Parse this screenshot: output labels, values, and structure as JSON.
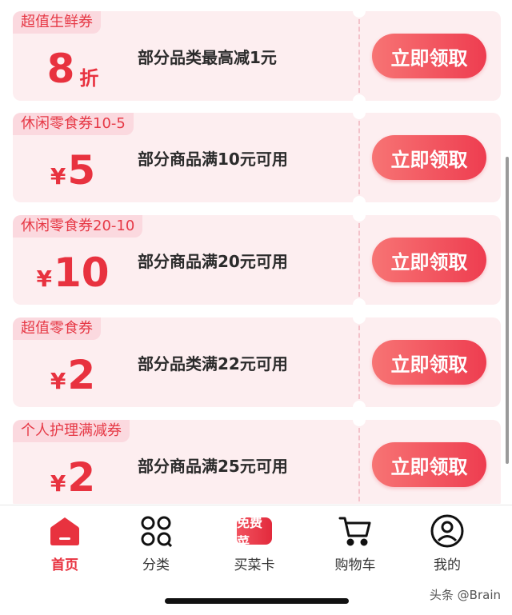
{
  "coupons": [
    {
      "tag": "超值生鲜券",
      "symbol": "",
      "amount": "8",
      "unit": "折",
      "desc": "部分品类最高减1元",
      "button": "立即领取"
    },
    {
      "tag": "休闲零食券10-5",
      "symbol": "¥",
      "amount": "5",
      "unit": "",
      "desc": "部分商品满10元可用",
      "button": "立即领取"
    },
    {
      "tag": "休闲零食券20-10",
      "symbol": "¥",
      "amount": "10",
      "unit": "",
      "desc": "部分商品满20元可用",
      "button": "立即领取"
    },
    {
      "tag": "超值零食券",
      "symbol": "¥",
      "amount": "2",
      "unit": "",
      "desc": "部分品类满22元可用",
      "button": "立即领取"
    },
    {
      "tag": "个人护理满减券",
      "symbol": "¥",
      "amount": "2",
      "unit": "",
      "desc": "部分商品满25元可用",
      "button": "立即领取"
    }
  ],
  "tabbar": {
    "items": [
      {
        "label": "首页",
        "icon": "home-icon",
        "active": true
      },
      {
        "label": "分类",
        "icon": "category-icon",
        "active": false
      },
      {
        "label": "买菜卡",
        "icon": "free-vegetable-badge",
        "badge": "免费菜",
        "active": false
      },
      {
        "label": "购物车",
        "icon": "cart-icon",
        "active": false
      },
      {
        "label": "我的",
        "icon": "profile-icon",
        "active": false
      }
    ]
  },
  "watermark": "头条 @Brain",
  "colors": {
    "accent": "#e8323f",
    "coupon_bg": "#fdeef0",
    "tag_bg": "#fbd9df"
  }
}
